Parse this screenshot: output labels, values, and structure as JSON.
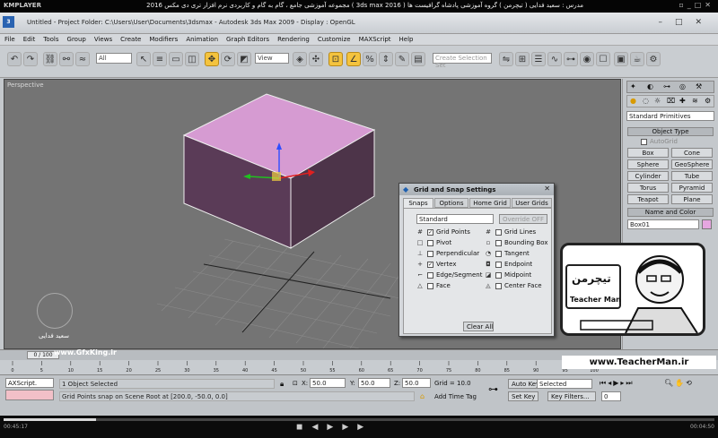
{
  "player": {
    "logo": "KMPLAYER",
    "title": "مجموعه آموزشی جامع ، گام به گام و کاربردی نرم افزار تری دی مکس 2016 ( 3ds max 2016 )   مدرس : سعید فدایی ( تیچرمن ) گروه آموزشی پادشاه گرافیست ها",
    "current_time": "00:45:17",
    "total_time": "00:04:50",
    "progress": 0.13
  },
  "max": {
    "title": "Untitled   - Project Folder: C:\\Users\\User\\Documents\\3dsmax       - Autodesk 3ds Max  2009        - Display : OpenGL",
    "menu": [
      "File",
      "Edit",
      "Tools",
      "Group",
      "Views",
      "Create",
      "Modifiers",
      "Animation",
      "Graph Editors",
      "Rendering",
      "Customize",
      "MAXScript",
      "Help"
    ],
    "toolbar": {
      "filter": "All",
      "refcoord": "View",
      "named_selection": "Create Selection Set"
    },
    "viewport": {
      "label": "Perspective"
    },
    "command_panel": {
      "category": "Standard Primitives",
      "object_type_title": "Object Type",
      "autogrid": "AutoGrid",
      "buttons": [
        "Box",
        "Cone",
        "Sphere",
        "GeoSphere",
        "Cylinder",
        "Tube",
        "Torus",
        "Pyramid",
        "Teapot",
        "Plane"
      ],
      "name_color_title": "Name and Color",
      "object_name": "Box01",
      "object_color": "#e5a6e0"
    },
    "grid_snap": {
      "title": "Grid and Snap Settings",
      "tabs": [
        "Snaps",
        "Options",
        "Home Grid",
        "User Grids"
      ],
      "active_tab": "Snaps",
      "mode": "Standard",
      "override": "Override OFF",
      "left": [
        {
          "label": "Grid Points",
          "checked": true
        },
        {
          "label": "Pivot",
          "checked": false
        },
        {
          "label": "Perpendicular",
          "checked": false
        },
        {
          "label": "Vertex",
          "checked": true
        },
        {
          "label": "Edge/Segment",
          "checked": false
        },
        {
          "label": "Face",
          "checked": false
        }
      ],
      "right": [
        {
          "label": "Grid Lines",
          "checked": false
        },
        {
          "label": "Bounding Box",
          "checked": false
        },
        {
          "label": "Tangent",
          "checked": false
        },
        {
          "label": "Endpoint",
          "checked": false
        },
        {
          "label": "Midpoint",
          "checked": false
        },
        {
          "label": "Center Face",
          "checked": false
        }
      ],
      "clear_all": "Clear All"
    },
    "timeslider": {
      "frame": "0 / 100"
    },
    "track_ticks": [
      "0",
      "5",
      "10",
      "15",
      "20",
      "25",
      "30",
      "35",
      "40",
      "45",
      "50",
      "55",
      "60",
      "65",
      "70",
      "75",
      "80",
      "85",
      "90",
      "95",
      "100"
    ],
    "status": {
      "script": "AXScript.",
      "selected": "1 Object Selected",
      "prompt": "Grid Points snap on Scene Root at [200.0, -50.0, 0.0]",
      "x_label": "X:",
      "x": "50.0",
      "y_label": "Y:",
      "y": "50.0",
      "z_label": "Z:",
      "z": "50.0",
      "grid": "Grid = 10.0",
      "add_time_tag": "Add Time Tag",
      "auto_key": "Auto Key",
      "set_key": "Set Key",
      "selected_dropdown": "Selected",
      "key_filters": "Key Filters...",
      "frame_field": "0"
    }
  },
  "overlay": {
    "url": "www.TeacherMan.ir",
    "brand": "Teacher Man",
    "brand_fa": "تیچرمن",
    "watermark_site": "www.GfxKing.ir",
    "watermark_name": "سعید فدایی"
  }
}
